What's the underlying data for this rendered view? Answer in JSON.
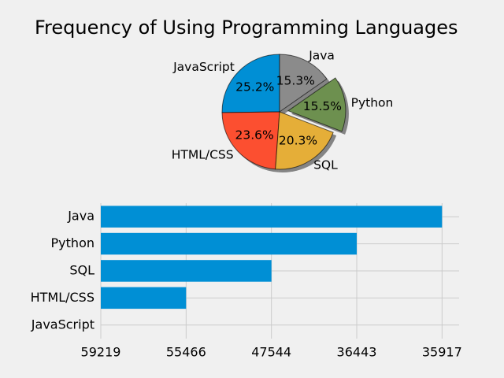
{
  "chart_data": [
    {
      "type": "pie",
      "title": "Frequency of Using Programming Languages",
      "categories": [
        "JavaScript",
        "HTML/CSS",
        "SQL",
        "Python",
        "Java"
      ],
      "values": [
        25.2,
        23.6,
        20.3,
        15.5,
        15.3
      ],
      "percent_labels": [
        "25.2%",
        "23.6%",
        "20.3%",
        "15.5%",
        "15.3%"
      ],
      "colors": [
        "#008fd5",
        "#fc4f30",
        "#e5ae38",
        "#6d904f",
        "#8b8b8b"
      ],
      "exploded": [
        "Python"
      ],
      "shadow": true,
      "start_angle_deg": 90,
      "counterclockwise": true
    },
    {
      "type": "bar",
      "orientation": "horizontal",
      "categories": [
        "JavaScript",
        "HTML/CSS",
        "SQL",
        "Python",
        "Java"
      ],
      "x_tick_labels": [
        "59219",
        "55466",
        "47544",
        "36443",
        "35917"
      ],
      "values": [
        0,
        1,
        2,
        3,
        4
      ],
      "xlim": [
        0,
        4.2
      ],
      "grid": true,
      "color": "#008fd5"
    }
  ]
}
